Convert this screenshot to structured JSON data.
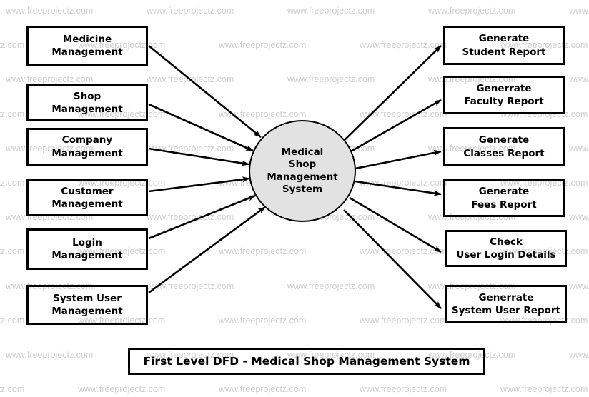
{
  "diagram": {
    "title": "First Level DFD - Medical Shop Management System",
    "watermark_text": "www.freeprojectz.com",
    "colors": {
      "stroke": "#000000",
      "process_fill": "#e2e2e2",
      "background": "#ffffff",
      "watermark": "#cccccc"
    },
    "process": {
      "name": "medical-shop-management-system-process",
      "lines": [
        "Medical",
        "Shop",
        "Management",
        "System"
      ]
    },
    "inputs": [
      {
        "id": "medicine-management",
        "lines": [
          "Medicine",
          "Management"
        ]
      },
      {
        "id": "shop-management",
        "lines": [
          "Shop",
          "Management"
        ]
      },
      {
        "id": "company-management",
        "lines": [
          "Company",
          "Management"
        ]
      },
      {
        "id": "customer-management",
        "lines": [
          "Customer",
          "Management"
        ]
      },
      {
        "id": "login-management",
        "lines": [
          "Login",
          "Management"
        ]
      },
      {
        "id": "system-user-management",
        "lines": [
          "System User",
          "Management"
        ]
      }
    ],
    "outputs": [
      {
        "id": "generate-student-report",
        "lines": [
          "Generate",
          "Student Report"
        ]
      },
      {
        "id": "generrate-faculty-report",
        "lines": [
          "Generrate",
          "Faculty Report"
        ]
      },
      {
        "id": "generate-classes-report",
        "lines": [
          "Generate",
          "Classes Report"
        ]
      },
      {
        "id": "generate-fees-report",
        "lines": [
          "Generate",
          "Fees Report"
        ]
      },
      {
        "id": "check-user-login-details",
        "lines": [
          "Check",
          "User Login Details"
        ]
      },
      {
        "id": "generrate-system-user-report",
        "lines": [
          "Generrate",
          "System User Report"
        ]
      }
    ]
  }
}
